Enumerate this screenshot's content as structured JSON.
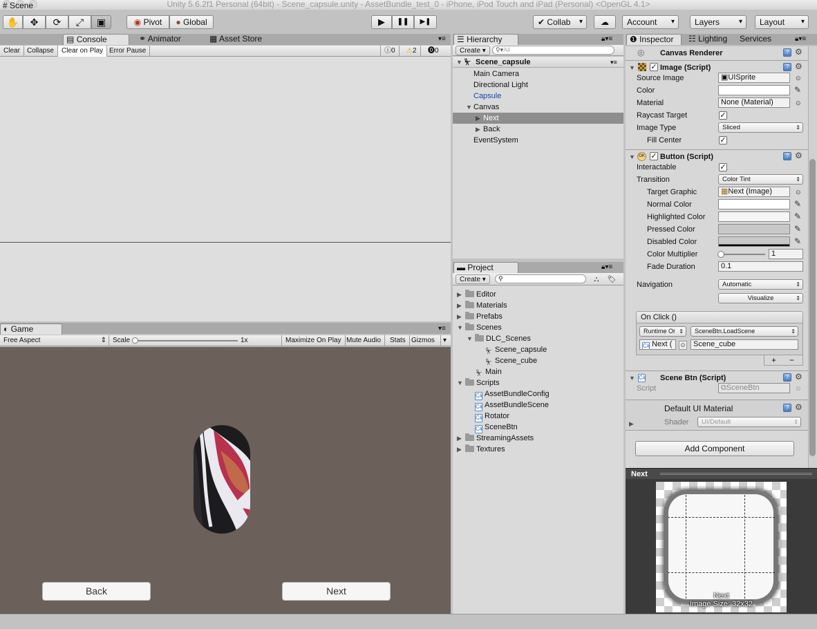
{
  "window": {
    "title": "Unity 5.6.2f1 Personal (64bit) - Scene_capsule.unity - AssetBundle_test_0 - iPhone, iPod Touch and iPad (Personal) <OpenGL 4.1>"
  },
  "toolbar": {
    "tools": [
      "hand-icon",
      "move-icon",
      "rotate-icon",
      "scale-icon",
      "rect-icon"
    ],
    "pivot": "Pivot",
    "global": "Global",
    "play_icon": "▶",
    "pause_icon": "❚❚",
    "step_icon": "▶❚",
    "collab": "Collab",
    "account": "Account",
    "layers": "Layers",
    "layout": "Layout"
  },
  "left_tabs": {
    "scene": "Scene",
    "console": "Console",
    "animator": "Animator",
    "asset_store": "Asset Store"
  },
  "console": {
    "clear": "Clear",
    "collapse": "Collapse",
    "clear_on_play": "Clear on Play",
    "error_pause": "Error Pause",
    "log_count": "0",
    "warn_count": "2",
    "error_count": "0"
  },
  "game": {
    "tab": "Game",
    "aspect": "Free Aspect",
    "scale_label": "Scale",
    "scale_value": "1x",
    "maximize": "Maximize On Play",
    "mute": "Mute Audio",
    "stats": "Stats",
    "gizmos": "Gizmos",
    "back_button": "Back",
    "next_button": "Next",
    "bg_color": "#6b605a"
  },
  "hierarchy": {
    "tab": "Hierarchy",
    "create": "Create",
    "search_placeholder": "All",
    "scene_name": "Scene_capsule",
    "items": [
      {
        "label": "Main Camera"
      },
      {
        "label": "Directional Light"
      },
      {
        "label": "Capsule"
      },
      {
        "label": "Canvas"
      },
      {
        "label": "Next"
      },
      {
        "label": "Back"
      },
      {
        "label": "EventSystem"
      }
    ]
  },
  "project": {
    "tab": "Project",
    "create": "Create",
    "items": [
      {
        "label": "Editor"
      },
      {
        "label": "Materials"
      },
      {
        "label": "Prefabs"
      },
      {
        "label": "Scenes"
      },
      {
        "label": "DLC_Scenes"
      },
      {
        "label": "Scene_capsule"
      },
      {
        "label": "Scene_cube"
      },
      {
        "label": "Main"
      },
      {
        "label": "Scripts"
      },
      {
        "label": "AssetBundleConfig"
      },
      {
        "label": "AssetBundleScene"
      },
      {
        "label": "Rotator"
      },
      {
        "label": "SceneBtn"
      },
      {
        "label": "StreamingAssets"
      },
      {
        "label": "Textures"
      }
    ]
  },
  "inspector": {
    "tab": "Inspector",
    "lighting_tab": "Lighting",
    "services_tab": "Services",
    "canvas_renderer": "Canvas Renderer",
    "image": {
      "title": "Image (Script)",
      "source_image_label": "Source Image",
      "source_image_value": "UISprite",
      "color_label": "Color",
      "material_label": "Material",
      "material_value": "None (Material)",
      "raycast_label": "Raycast Target",
      "image_type_label": "Image Type",
      "image_type_value": "Sliced",
      "fill_center_label": "Fill Center"
    },
    "button": {
      "title": "Button (Script)",
      "interactable_label": "Interactable",
      "transition_label": "Transition",
      "transition_value": "Color Tint",
      "target_graphic_label": "Target Graphic",
      "target_graphic_value": "Next (Image)",
      "normal_label": "Normal Color",
      "highlighted_label": "Highlighted Color",
      "pressed_label": "Pressed Color",
      "disabled_label": "Disabled Color",
      "multiplier_label": "Color Multiplier",
      "multiplier_value": "1",
      "multiplier_fraction": 0,
      "fade_label": "Fade Duration",
      "fade_value": "0.1",
      "navigation_label": "Navigation",
      "navigation_value": "Automatic",
      "visualize": "Visualize",
      "onclick_title": "On Click ()",
      "runtime_value": "Runtime Or",
      "function_value": "SceneBtn.LoadScene",
      "object_value": "Next (",
      "arg_value": "Scene_cube",
      "plus": "+",
      "minus": "−"
    },
    "scene_btn": {
      "title": "Scene Btn (Script)",
      "script_label": "Script",
      "script_value": "SceneBtn"
    },
    "material": {
      "title": "Default UI Material",
      "shader_label": "Shader",
      "shader_value": "UI/Default"
    },
    "add_component": "Add Component"
  },
  "preview": {
    "title": "Next",
    "name": "Next",
    "size": "Image Size: 32x32"
  }
}
